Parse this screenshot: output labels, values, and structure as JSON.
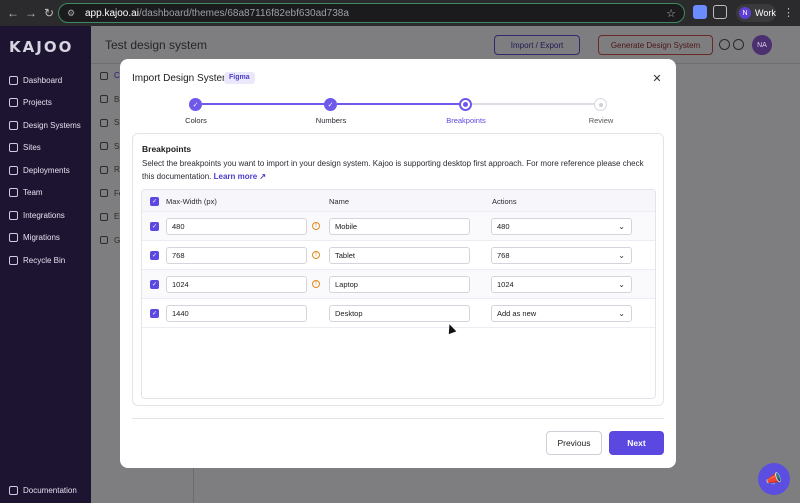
{
  "browser": {
    "url_host": "app.kajoo.ai",
    "url_path": "/dashboard/themes/68a87116f82ebf630ad738a",
    "profile_initial": "N",
    "profile_label": "Work"
  },
  "sidebar": {
    "logo": "KAJOO",
    "items": [
      {
        "label": "Dashboard",
        "icon": "dashboard-icon"
      },
      {
        "label": "Projects",
        "icon": "projects-icon"
      },
      {
        "label": "Design Systems",
        "icon": "palette-icon"
      },
      {
        "label": "Sites",
        "icon": "globe-icon"
      },
      {
        "label": "Deployments",
        "icon": "rocket-icon"
      },
      {
        "label": "Team",
        "icon": "team-icon"
      },
      {
        "label": "Integrations",
        "icon": "plug-icon"
      },
      {
        "label": "Migrations",
        "icon": "migrate-icon"
      },
      {
        "label": "Recycle Bin",
        "icon": "trash-icon"
      }
    ],
    "documentation": "Documentation"
  },
  "page": {
    "title": "Test design system",
    "import_export": "Import / Export",
    "generate": "Generate Design System",
    "avatar_initials": "NA",
    "subnav": [
      "Co",
      "Br",
      "Si",
      "Sp",
      "Ra",
      "Fo",
      "El",
      "Gl"
    ]
  },
  "modal": {
    "title": "Import Design System",
    "tag": "Figma",
    "steps": [
      {
        "label": "Colors",
        "state": "done"
      },
      {
        "label": "Numbers",
        "state": "done"
      },
      {
        "label": "Breakpoints",
        "state": "current"
      },
      {
        "label": "Review",
        "state": "todo"
      }
    ],
    "section_title": "Breakpoints",
    "description": "Select the breakpoints you want to import in your design system. Kajoo is supporting desktop first approach. For more reference please check this documentation.",
    "learn_more": "Learn more",
    "columns": {
      "max_width": "Max-Width (px)",
      "name": "Name",
      "actions": "Actions"
    },
    "rows": [
      {
        "max_width": "480",
        "name": "Mobile",
        "action": "480",
        "warning": true,
        "checked": true
      },
      {
        "max_width": "768",
        "name": "Tablet",
        "action": "768",
        "warning": true,
        "checked": true
      },
      {
        "max_width": "1024",
        "name": "Laptop",
        "action": "1024",
        "warning": true,
        "checked": true
      },
      {
        "max_width": "1440",
        "name": "Desktop",
        "action": "Add as new",
        "warning": false,
        "checked": true
      }
    ],
    "previous": "Previous",
    "next": "Next"
  }
}
